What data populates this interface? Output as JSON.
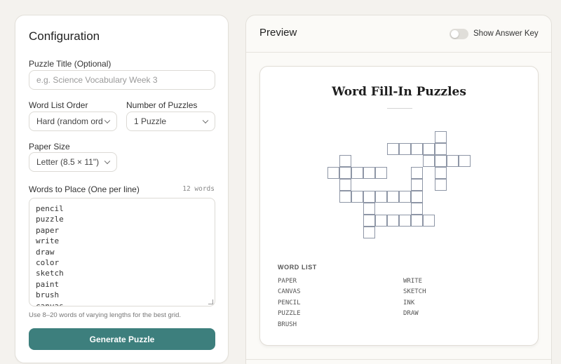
{
  "config": {
    "title": "Configuration",
    "puzzle_title_label": "Puzzle Title (Optional)",
    "puzzle_title_placeholder": "e.g. Science Vocabulary Week 3",
    "word_order_label": "Word List Order",
    "word_order_value": "Hard (random orde",
    "num_puzzles_label": "Number of Puzzles",
    "num_puzzles_value": "1 Puzzle",
    "paper_size_label": "Paper Size",
    "paper_size_value": "Letter (8.5 × 11\")",
    "words_label": "Words to Place (One per line)",
    "word_count": "12 words",
    "words": [
      "pencil",
      "puzzle",
      "paper",
      "write",
      "draw",
      "color",
      "sketch",
      "paint",
      "brush",
      "canvas"
    ],
    "hint": "Use 8–20 words of varying lengths for the best grid.",
    "generate_button": "Generate Puzzle"
  },
  "preview": {
    "title": "Preview",
    "answer_key_label": "Show Answer Key",
    "answer_key_on": false,
    "sheet_title": "Word Fill-In Puzzles",
    "word_list_heading": "WORD LIST",
    "word_list_left": [
      "PAPER",
      "CANVAS",
      "PENCIL",
      "PUZZLE",
      "BRUSH"
    ],
    "word_list_right": [
      "WRITE",
      "SKETCH",
      "INK",
      "DRAW"
    ]
  },
  "colors": {
    "accent": "#3d7f7d",
    "cell_border": "#8e96a6",
    "background": "#f4f2ee"
  }
}
